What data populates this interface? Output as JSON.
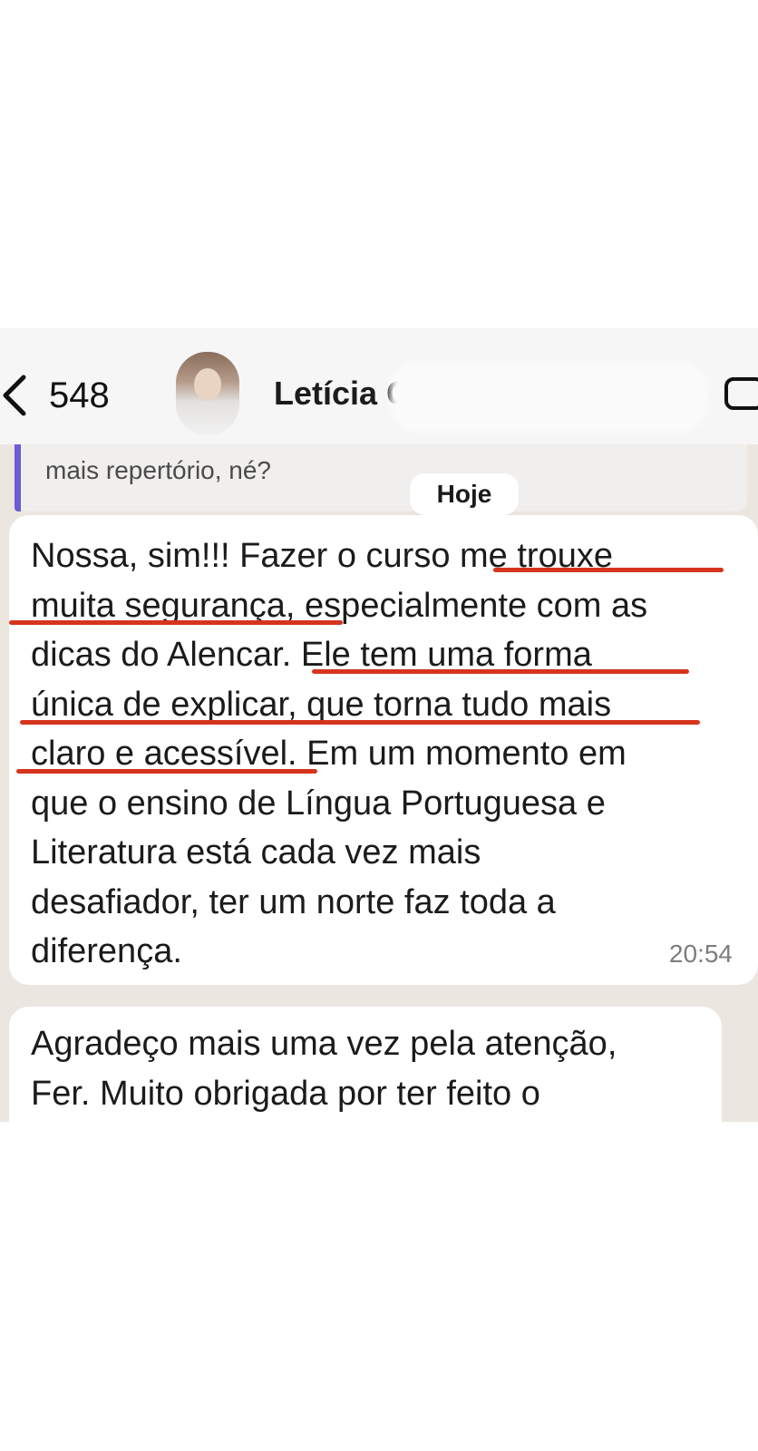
{
  "header": {
    "back_count": "548",
    "contact_name": "Letícia Ga"
  },
  "quote": {
    "text": "mais repertório, né?"
  },
  "date_chip": "Hoje",
  "message1": {
    "lines": [
      "Nossa, sim!!! Fazer o curso me trouxe",
      "muita segurança, especialmente com as",
      "dicas do Alencar. Ele tem uma forma",
      "única de explicar, que torna tudo mais",
      "claro e acessível. Em um momento em",
      "que o ensino de Língua Portuguesa e",
      "Literatura está cada vez mais",
      "desafiador, ter um norte faz toda a",
      "diferença."
    ],
    "time": "20:54"
  },
  "message2": {
    "lines": [
      "Agradeço mais uma vez pela atenção,",
      "Fer. Muito obrigada por ter feito o"
    ]
  },
  "colors": {
    "underline": "#d6341d",
    "quote_accent": "#6d5cd6",
    "chat_background": "#ebe6e0"
  },
  "icons": [
    "chevron-left-icon",
    "video-call-icon"
  ]
}
